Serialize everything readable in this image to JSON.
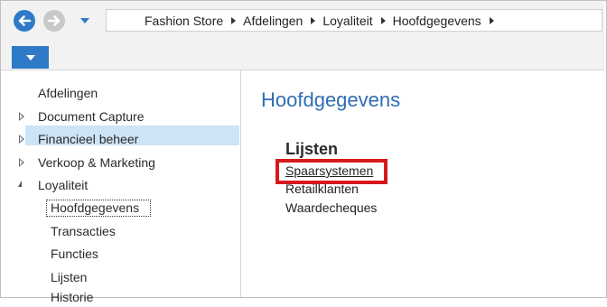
{
  "breadcrumb": [
    "Fashion Store",
    "Afdelingen",
    "Loyaliteit",
    "Hoofdgegevens"
  ],
  "sidebar": {
    "items": [
      {
        "label": "Afdelingen"
      },
      {
        "label": "Document Capture"
      },
      {
        "label": "Financieel beheer"
      },
      {
        "label": "Verkoop & Marketing"
      },
      {
        "label": "Loyaliteit"
      },
      {
        "label": "Hoofdgegevens"
      },
      {
        "label": "Transacties"
      },
      {
        "label": "Functies"
      },
      {
        "label": "Lijsten"
      },
      {
        "label": "Historie"
      }
    ]
  },
  "main": {
    "title": "Hoofdgegevens",
    "section_heading": "Lijsten",
    "links": [
      "Spaarsystemen",
      "Retailklanten",
      "Waardecheques"
    ]
  },
  "colors": {
    "accent": "#2f7ac6",
    "title": "#2f6db2",
    "selection": "#cde3f6",
    "highlight": "#d7191c"
  },
  "icons": [
    "back-arrow-icon",
    "forward-arrow-icon",
    "chevron-down-icon",
    "expand-triangle-icon",
    "collapse-triangle-icon"
  ]
}
